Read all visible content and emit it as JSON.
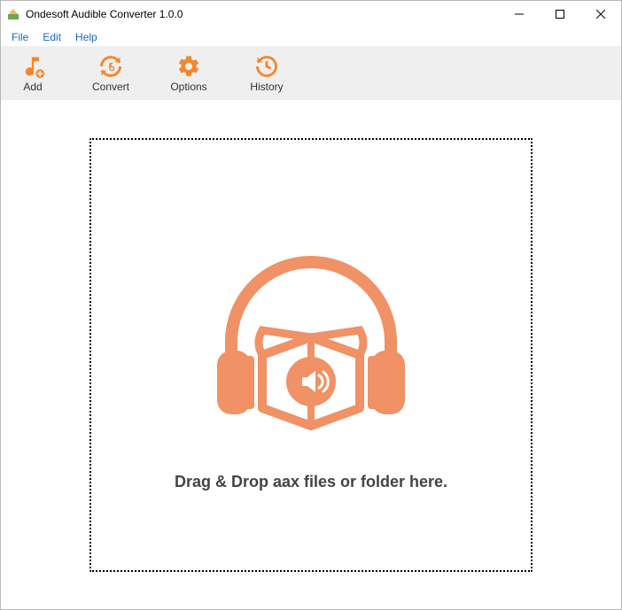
{
  "titlebar": {
    "title": "Ondesoft Audible Converter 1.0.0"
  },
  "menu": {
    "items": [
      "File",
      "Edit",
      "Help"
    ]
  },
  "toolbar": {
    "add_label": "Add",
    "convert_label": "Convert",
    "options_label": "Options",
    "history_label": "History"
  },
  "dropzone": {
    "instruction": "Drag & Drop aax files or folder here."
  },
  "colors": {
    "accent": "#f3872f"
  }
}
